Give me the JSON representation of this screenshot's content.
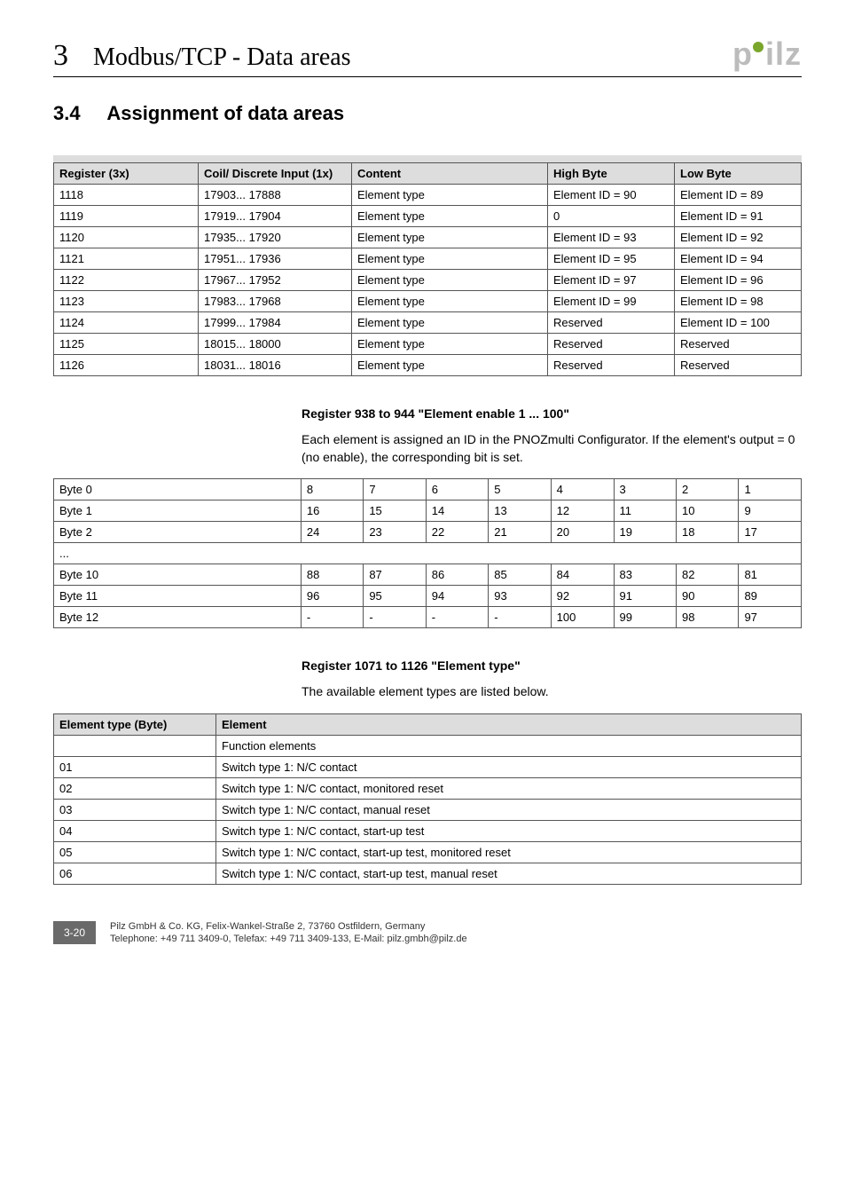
{
  "chapter": {
    "num": "3",
    "title": "Modbus/TCP - Data areas"
  },
  "logo": "pilz",
  "section": {
    "num": "3.4",
    "title": "Assignment of data areas"
  },
  "table1": {
    "headers": {
      "register": "Register (3x)",
      "coil": "Coil/\nDiscrete Input (1x)",
      "content": "Content",
      "high": "High Byte",
      "low": "Low Byte"
    },
    "rows": [
      {
        "r": "1118",
        "c": "17903... 17888",
        "ct": "Element type",
        "h": "Element ID = 90",
        "l": "Element ID = 89"
      },
      {
        "r": "1119",
        "c": "17919... 17904",
        "ct": "Element type",
        "h": "0",
        "l": "Element ID = 91"
      },
      {
        "r": "1120",
        "c": "17935... 17920",
        "ct": "Element type",
        "h": "Element ID = 93",
        "l": "Element ID = 92"
      },
      {
        "r": "1121",
        "c": "17951... 17936",
        "ct": "Element type",
        "h": "Element ID = 95",
        "l": "Element ID = 94"
      },
      {
        "r": "1122",
        "c": "17967... 17952",
        "ct": "Element type",
        "h": "Element ID = 97",
        "l": "Element ID = 96"
      },
      {
        "r": "1123",
        "c": "17983... 17968",
        "ct": "Element type",
        "h": "Element ID = 99",
        "l": "Element ID = 98"
      },
      {
        "r": "1124",
        "c": "17999... 17984",
        "ct": "Element type",
        "h": "Reserved",
        "l": "Element ID = 100"
      },
      {
        "r": "1125",
        "c": "18015... 18000",
        "ct": "Element type",
        "h": "Reserved",
        "l": "Reserved"
      },
      {
        "r": "1126",
        "c": "18031... 18016",
        "ct": "Element type",
        "h": "Reserved",
        "l": "Reserved"
      }
    ]
  },
  "reg938": {
    "title": "Register 938 to 944 \"Element enable 1 ... 100\"",
    "desc": "Each element is assigned an ID in the PNOZmulti Configurator. If the element's output = 0 (no enable), the corresponding bit is set.",
    "rows": [
      {
        "label": "Byte 0",
        "c": [
          "8",
          "7",
          "6",
          "5",
          "4",
          "3",
          "2",
          "1"
        ]
      },
      {
        "label": "Byte 1",
        "c": [
          "16",
          "15",
          "14",
          "13",
          "12",
          "11",
          "10",
          "9"
        ]
      },
      {
        "label": "Byte 2",
        "c": [
          "24",
          "23",
          "22",
          "21",
          "20",
          "19",
          "18",
          "17"
        ]
      },
      {
        "label": "...",
        "c": [
          "",
          "",
          "",
          "",
          "",
          "",
          "",
          ""
        ],
        "span": true
      },
      {
        "label": "Byte 10",
        "c": [
          "88",
          "87",
          "86",
          "85",
          "84",
          "83",
          "82",
          "81"
        ]
      },
      {
        "label": "Byte 11",
        "c": [
          "96",
          "95",
          "94",
          "93",
          "92",
          "91",
          "90",
          "89"
        ]
      },
      {
        "label": "Byte 12",
        "c": [
          "-",
          "-",
          "-",
          "-",
          "100",
          "99",
          "98",
          "97"
        ]
      }
    ]
  },
  "reg1071": {
    "title": "Register 1071 to 1126 \"Element type\"",
    "desc": "The available element types are listed below.",
    "headers": {
      "byte": "Element type (Byte)",
      "elem": "Element"
    },
    "rows": [
      {
        "b": "",
        "e": "Function elements"
      },
      {
        "b": "01",
        "e": "Switch type 1: N/C contact"
      },
      {
        "b": "02",
        "e": "Switch type 1: N/C contact, monitored reset"
      },
      {
        "b": "03",
        "e": "Switch type 1: N/C contact, manual reset"
      },
      {
        "b": "04",
        "e": "Switch type 1: N/C contact, start-up test"
      },
      {
        "b": "05",
        "e": "Switch type 1: N/C contact, start-up test, monitored reset"
      },
      {
        "b": "06",
        "e": "Switch type 1: N/C contact, start-up test, manual reset"
      }
    ]
  },
  "footer": {
    "page": "3-20",
    "line1": "Pilz GmbH & Co. KG, Felix-Wankel-Straße 2, 73760 Ostfildern, Germany",
    "line2": "Telephone: +49 711 3409-0, Telefax: +49 711 3409-133, E-Mail: pilz.gmbh@pilz.de"
  }
}
